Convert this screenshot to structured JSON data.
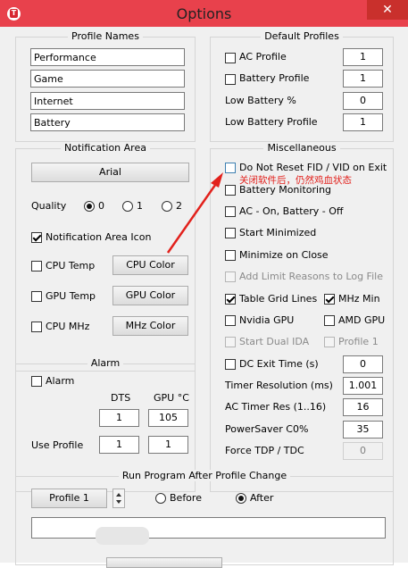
{
  "window": {
    "title": "Options",
    "close_glyph": "✕",
    "app_icon_letter": "T"
  },
  "profile_names": {
    "title": "Profile Names",
    "items": [
      "Performance",
      "Game",
      "Internet",
      "Battery"
    ]
  },
  "default_profiles": {
    "title": "Default Profiles",
    "ac_profile": {
      "label": "AC Profile",
      "value": "1",
      "checked": false
    },
    "battery_profile": {
      "label": "Battery Profile",
      "value": "1",
      "checked": false
    },
    "low_battery_pct": {
      "label": "Low Battery %",
      "value": "0"
    },
    "low_battery_profile": {
      "label": "Low Battery Profile",
      "value": "1"
    }
  },
  "notification_area": {
    "title": "Notification Area",
    "font_button": "Arial",
    "quality_label": "Quality",
    "quality_options": [
      "0",
      "1",
      "2"
    ],
    "quality_selected": "0",
    "icon_label": "Notification Area Icon",
    "cpu_temp": "CPU Temp",
    "cpu_color": "CPU Color",
    "gpu_temp": "GPU Temp",
    "gpu_color": "GPU Color",
    "cpu_mhz": "CPU MHz",
    "mhz_color": "MHz Color"
  },
  "alarm": {
    "title": "Alarm",
    "alarm_label": "Alarm",
    "dts_header": "DTS",
    "gpu_header": "GPU °C",
    "dts_value": "1",
    "gpu_value": "105",
    "use_profile_label": "Use Profile",
    "use_profile_dts": "1",
    "use_profile_gpu": "1"
  },
  "misc": {
    "title": "Miscellaneous",
    "do_not_reset": "Do Not Reset FID / VID on Exit",
    "annotation": "关闭软件后，仍然鸡血状态",
    "battery_monitoring": "Battery Monitoring",
    "ac_on_battery_off": "AC - On, Battery - Off",
    "start_minimized": "Start Minimized",
    "minimize_on_close": "Minimize on Close",
    "add_limit_reasons": "Add Limit Reasons to Log File",
    "table_grid_lines": "Table Grid Lines",
    "mhz_min": "MHz Min",
    "nvidia_gpu": "Nvidia GPU",
    "amd_gpu": "AMD GPU",
    "start_dual_ida": "Start Dual IDA",
    "profile_1": "Profile 1",
    "dc_exit_time": "DC Exit Time (s)",
    "dc_exit_value": "0",
    "timer_resolution": "Timer Resolution (ms)",
    "timer_resolution_value": "1.001",
    "ac_timer_res": "AC Timer Res (1..16)",
    "ac_timer_res_value": "16",
    "powersaver": "PowerSaver C0%",
    "powersaver_value": "35",
    "force_tdp": "Force TDP / TDC",
    "force_tdp_value": "0"
  },
  "run_program": {
    "title": "Run Program After Profile Change",
    "profile_button": "Profile 1",
    "before_label": "Before",
    "after_label": "After",
    "selected": "After",
    "path_value": ""
  },
  "colors": {
    "titlebar": "#e8414c",
    "annotation": "#e2211c"
  }
}
